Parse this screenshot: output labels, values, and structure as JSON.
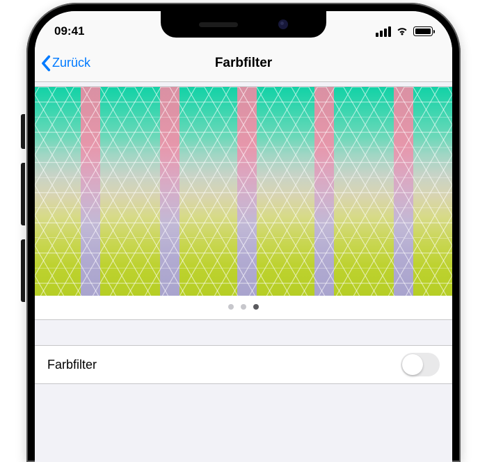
{
  "status": {
    "time": "09:41"
  },
  "nav": {
    "back_label": "Zurück",
    "title": "Farbfilter"
  },
  "pager": {
    "total": 3,
    "active_index": 2
  },
  "toggle": {
    "label": "Farbfilter",
    "on": false
  }
}
